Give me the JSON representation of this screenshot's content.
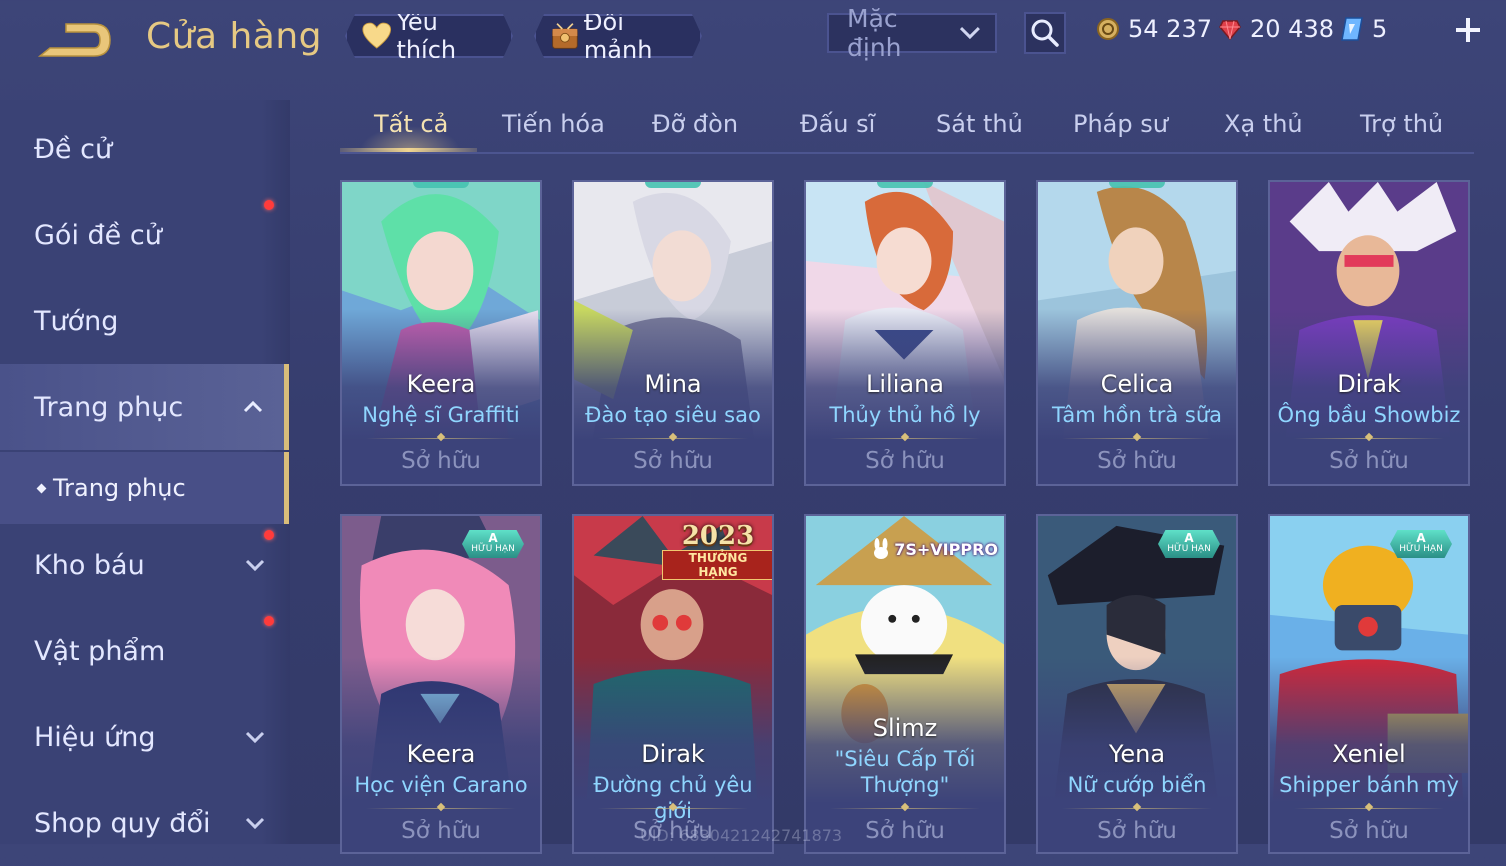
{
  "header": {
    "title": "Cửa hàng",
    "favorites_label": "Yêu thích",
    "exchange_label": "Đổi mảnh",
    "sort_value": "Mặc định",
    "gold": "54 237",
    "ruby": "20 438",
    "voucher": "5"
  },
  "sidebar": {
    "items": [
      {
        "label": "Đề cử"
      },
      {
        "label": "Gói đề cử"
      },
      {
        "label": "Tướng"
      },
      {
        "label": "Trang phục"
      },
      {
        "label": "Trang phục"
      },
      {
        "label": "Kho báu"
      },
      {
        "label": "Vật phẩm"
      },
      {
        "label": "Hiệu ứng"
      },
      {
        "label": "Shop quy đổi"
      }
    ]
  },
  "tabs": [
    "Tất cả",
    "Tiến hóa",
    "Đỡ đòn",
    "Đấu sĩ",
    "Sát thủ",
    "Pháp sư",
    "Xạ thủ",
    "Trợ thủ"
  ],
  "cards": [
    {
      "hero": "Keera",
      "skin": "Nghệ sĩ Graffiti",
      "status": "Sở hữu"
    },
    {
      "hero": "Mina",
      "skin": "Đào tạo siêu sao",
      "status": "Sở hữu"
    },
    {
      "hero": "Liliana",
      "skin": "Thủy thủ hồ ly",
      "status": "Sở hữu"
    },
    {
      "hero": "Celica",
      "skin": "Tâm hồn trà sữa",
      "status": "Sở hữu"
    },
    {
      "hero": "Dirak",
      "skin": "Ông bầu Showbiz",
      "status": "Sở hữu"
    },
    {
      "hero": "Keera",
      "skin": "Học viện Carano",
      "status": "Sở hữu",
      "badge_a": "A",
      "badge_text": "HỮU HẠN"
    },
    {
      "hero": "Dirak",
      "skin": "Đường chủ yêu giới",
      "status": "Sở hữu",
      "badge_year": "2023",
      "badge_rank": "THƯỞNG HẠNG"
    },
    {
      "hero": "Slimz",
      "skin_line1": "\"Siêu Cấp Tối",
      "skin_line2": "Thượng\"",
      "status": "Sở hữu",
      "badge_vip": "7S+VIPPRO"
    },
    {
      "hero": "Yena",
      "skin": "Nữ cướp biển",
      "status": "Sở hữu",
      "badge_a": "A",
      "badge_text": "HỮU HẠN"
    },
    {
      "hero": "Xeniel",
      "skin": "Shipper bánh mỳ",
      "status": "Sở hữu",
      "badge_a": "A",
      "badge_text": "HỮU HẠN"
    }
  ],
  "watermark": "UID: 6830421242741873",
  "colors": {
    "accent_gold": "#e6c983",
    "skin_name": "#8fd6ff",
    "notification": "#ff3b3b"
  }
}
